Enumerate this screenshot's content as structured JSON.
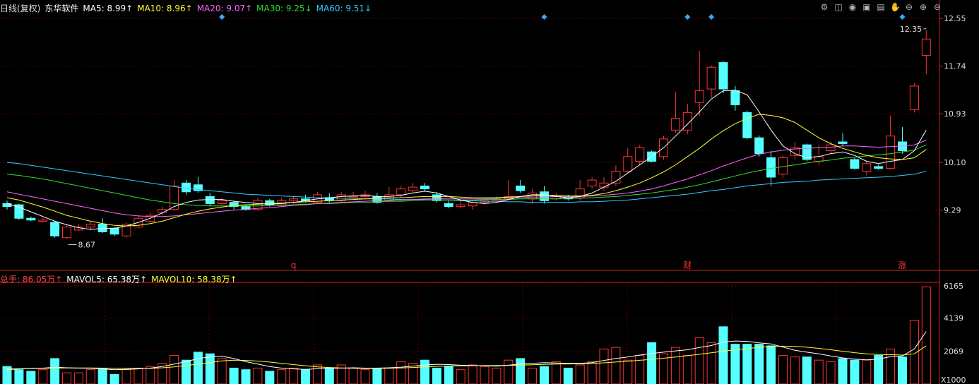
{
  "stock": {
    "title": "日线(复权)",
    "name": "东华软件"
  },
  "ma_header": [
    {
      "label": "MA5: 8.99↑",
      "color": "#ffffff"
    },
    {
      "label": "MA10: 8.96↑",
      "color": "#ffff33"
    },
    {
      "label": "MA20: 9.07↑",
      "color": "#ff66ff"
    },
    {
      "label": "MA30: 9.25↓",
      "color": "#33dd33"
    },
    {
      "label": "MA60: 9.51↓",
      "color": "#33ccff"
    }
  ],
  "vol_header": [
    {
      "label": "总手: 86.05万↑",
      "color": "#ff4444"
    },
    {
      "label": "MAVOL5: 65.38万↑",
      "color": "#ffffff"
    },
    {
      "label": "MAVOL10: 58.38万↑",
      "color": "#ffff33"
    }
  ],
  "toolbar_icons": [
    "settings-icon",
    "eye-icon",
    "lock-icon",
    "box-icon",
    "hand-icon",
    "minus-circle-icon",
    "plus-circle-icon",
    "minus-icon"
  ],
  "toolbar_glyphs": [
    "⚙",
    "◫",
    "◉",
    "▣",
    "▤",
    "✋",
    "⊖",
    "⊕",
    "⊖"
  ],
  "chart_data": {
    "type": "candlestick",
    "price_axis": {
      "ticks": [
        "12.55",
        "11.74",
        "10.93",
        "10.10",
        "9.29"
      ],
      "ylim": [
        8.3,
        12.6
      ]
    },
    "volume_axis": {
      "ticks": [
        "6165",
        "4139",
        "2069"
      ],
      "unit": "X1000"
    },
    "price_annotations": {
      "high_label": "12.35",
      "low_label": "8.67"
    },
    "markers": [
      {
        "text": "q",
        "index": 24
      },
      {
        "text": "财",
        "index": 57
      },
      {
        "text": "涨",
        "index": 75
      }
    ],
    "event_diamonds": [
      18,
      45,
      57,
      59,
      75
    ],
    "colors": {
      "up": "#ff3333",
      "down": "#55ffff",
      "grid": "#5a0000",
      "axis": "#cc2222",
      "text": "#dddddd"
    },
    "candles": [
      [
        9.4,
        9.35,
        9.45,
        9.3
      ],
      [
        9.38,
        9.15,
        9.4,
        9.12
      ],
      [
        9.15,
        9.12,
        9.18,
        9.1
      ],
      [
        9.1,
        9.12,
        9.15,
        9.08
      ],
      [
        9.08,
        8.85,
        9.1,
        8.82
      ],
      [
        8.82,
        9.0,
        9.05,
        8.8
      ],
      [
        8.95,
        9.0,
        9.05,
        8.93
      ],
      [
        9.0,
        9.05,
        9.08,
        8.95
      ],
      [
        9.05,
        8.92,
        9.15,
        8.9
      ],
      [
        8.98,
        8.88,
        9.0,
        8.85
      ],
      [
        8.85,
        9.05,
        9.08,
        8.82
      ],
      [
        9.0,
        9.15,
        9.2,
        8.98
      ],
      [
        9.1,
        9.2,
        9.25,
        9.08
      ],
      [
        9.25,
        9.3,
        9.35,
        9.2
      ],
      [
        9.3,
        9.7,
        9.8,
        9.28
      ],
      [
        9.75,
        9.6,
        9.8,
        9.55
      ],
      [
        9.72,
        9.62,
        9.85,
        9.58
      ],
      [
        9.52,
        9.4,
        9.58,
        9.35
      ],
      [
        9.4,
        9.45,
        9.5,
        9.38
      ],
      [
        9.42,
        9.35,
        9.45,
        9.3
      ],
      [
        9.35,
        9.3,
        9.38,
        9.28
      ],
      [
        9.3,
        9.45,
        9.5,
        9.28
      ],
      [
        9.45,
        9.38,
        9.48,
        9.35
      ],
      [
        9.38,
        9.45,
        9.5,
        9.35
      ],
      [
        9.45,
        9.48,
        9.52,
        9.4
      ],
      [
        9.48,
        9.45,
        9.55,
        9.42
      ],
      [
        9.42,
        9.55,
        9.6,
        9.4
      ],
      [
        9.5,
        9.45,
        9.58,
        9.42
      ],
      [
        9.45,
        9.55,
        9.6,
        9.43
      ],
      [
        9.5,
        9.52,
        9.6,
        9.48
      ],
      [
        9.52,
        9.55,
        9.62,
        9.5
      ],
      [
        9.52,
        9.42,
        9.58,
        9.4
      ],
      [
        9.45,
        9.55,
        9.68,
        9.42
      ],
      [
        9.55,
        9.65,
        9.7,
        9.5
      ],
      [
        9.62,
        9.68,
        9.75,
        9.58
      ],
      [
        9.7,
        9.65,
        9.75,
        9.6
      ],
      [
        9.55,
        9.45,
        9.6,
        9.42
      ],
      [
        9.4,
        9.35,
        9.45,
        9.32
      ],
      [
        9.35,
        9.38,
        9.45,
        9.32
      ],
      [
        9.36,
        9.42,
        9.46,
        9.3
      ],
      [
        9.42,
        9.45,
        9.5,
        9.38
      ],
      [
        9.45,
        9.48,
        9.52,
        9.42
      ],
      [
        9.48,
        9.52,
        9.8,
        9.45
      ],
      [
        9.7,
        9.62,
        9.8,
        9.58
      ],
      [
        9.48,
        9.58,
        9.65,
        9.4
      ],
      [
        9.6,
        9.45,
        9.7,
        9.4
      ],
      [
        9.48,
        9.52,
        9.58,
        9.45
      ],
      [
        9.5,
        9.48,
        9.55,
        9.45
      ],
      [
        9.5,
        9.65,
        9.8,
        9.45
      ],
      [
        9.7,
        9.8,
        9.85,
        9.65
      ],
      [
        9.68,
        9.75,
        9.85,
        9.62
      ],
      [
        9.75,
        9.95,
        10.05,
        9.7
      ],
      [
        9.95,
        10.2,
        10.35,
        9.92
      ],
      [
        10.12,
        10.35,
        10.4,
        10.05
      ],
      [
        10.28,
        10.12,
        10.3,
        10.1
      ],
      [
        10.2,
        10.5,
        10.55,
        10.15
      ],
      [
        10.65,
        10.85,
        11.3,
        10.6
      ],
      [
        10.65,
        10.95,
        11.1,
        10.58
      ],
      [
        11.12,
        11.32,
        12.0,
        10.88
      ],
      [
        11.35,
        11.72,
        11.75,
        11.2
      ],
      [
        11.8,
        11.35,
        11.82,
        11.28
      ],
      [
        11.32,
        11.08,
        11.4,
        10.98
      ],
      [
        10.95,
        10.52,
        10.98,
        10.5
      ],
      [
        10.52,
        10.25,
        10.56,
        10.2
      ],
      [
        10.18,
        9.85,
        10.3,
        9.7
      ],
      [
        9.9,
        10.18,
        10.22,
        9.84
      ],
      [
        10.22,
        10.35,
        10.45,
        10.15
      ],
      [
        10.4,
        10.15,
        10.42,
        10.12
      ],
      [
        10.12,
        10.2,
        10.4,
        10.05
      ],
      [
        10.3,
        10.4,
        10.45,
        10.25
      ],
      [
        10.45,
        10.42,
        10.6,
        10.38
      ],
      [
        10.15,
        10.0,
        10.18,
        9.98
      ],
      [
        9.95,
        10.08,
        10.12,
        9.88
      ],
      [
        10.03,
        10.0,
        10.06,
        9.98
      ],
      [
        10.0,
        10.55,
        10.9,
        9.98
      ],
      [
        10.45,
        10.3,
        10.7,
        10.25
      ],
      [
        11.0,
        11.4,
        11.45,
        10.95
      ],
      [
        11.92,
        12.2,
        12.35,
        11.6
      ]
    ],
    "ma5": [
      9.4,
      9.34,
      9.26,
      9.18,
      9.1,
      9.04,
      8.99,
      8.96,
      8.98,
      8.98,
      9.02,
      9.08,
      9.15,
      9.24,
      9.35,
      9.42,
      9.46,
      9.47,
      9.47,
      9.44,
      9.42,
      9.4,
      9.39,
      9.4,
      9.42,
      9.45,
      9.48,
      9.5,
      9.52,
      9.53,
      9.54,
      9.52,
      9.52,
      9.54,
      9.58,
      9.61,
      9.58,
      9.52,
      9.46,
      9.42,
      9.4,
      9.42,
      9.47,
      9.52,
      9.55,
      9.55,
      9.52,
      9.5,
      9.52,
      9.58,
      9.68,
      9.78,
      9.92,
      10.06,
      10.2,
      10.35,
      10.55,
      10.75,
      10.96,
      11.18,
      11.32,
      11.33,
      11.25,
      10.96,
      10.65,
      10.38,
      10.25,
      10.18,
      10.2,
      10.25,
      10.28,
      10.22,
      10.12,
      10.08,
      10.12,
      10.15,
      10.3,
      10.65
    ],
    "ma10": [
      9.5,
      9.46,
      9.4,
      9.34,
      9.27,
      9.2,
      9.15,
      9.1,
      9.06,
      9.03,
      9.02,
      9.03,
      9.06,
      9.1,
      9.16,
      9.22,
      9.27,
      9.31,
      9.34,
      9.37,
      9.38,
      9.39,
      9.4,
      9.41,
      9.42,
      9.43,
      9.44,
      9.45,
      9.46,
      9.47,
      9.48,
      9.49,
      9.5,
      9.5,
      9.51,
      9.52,
      9.52,
      9.52,
      9.51,
      9.5,
      9.5,
      9.5,
      9.51,
      9.52,
      9.53,
      9.54,
      9.54,
      9.53,
      9.53,
      9.54,
      9.57,
      9.62,
      9.68,
      9.75,
      9.84,
      9.94,
      10.06,
      10.2,
      10.34,
      10.5,
      10.64,
      10.76,
      10.85,
      10.92,
      10.9,
      10.86,
      10.78,
      10.65,
      10.52,
      10.42,
      10.34,
      10.28,
      10.22,
      10.18,
      10.16,
      10.15,
      10.18,
      10.32
    ],
    "ma20": [
      9.6,
      9.56,
      9.52,
      9.48,
      9.44,
      9.4,
      9.36,
      9.32,
      9.28,
      9.24,
      9.21,
      9.19,
      9.18,
      9.18,
      9.19,
      9.21,
      9.23,
      9.25,
      9.27,
      9.29,
      9.3,
      9.32,
      9.33,
      9.35,
      9.37,
      9.38,
      9.4,
      9.41,
      9.42,
      9.43,
      9.44,
      9.45,
      9.46,
      9.46,
      9.47,
      9.48,
      9.48,
      9.48,
      9.48,
      9.48,
      9.48,
      9.49,
      9.5,
      9.5,
      9.51,
      9.51,
      9.52,
      9.52,
      9.52,
      9.53,
      9.54,
      9.56,
      9.58,
      9.61,
      9.65,
      9.7,
      9.76,
      9.82,
      9.89,
      9.96,
      10.04,
      10.11,
      10.18,
      10.24,
      10.28,
      10.31,
      10.33,
      10.34,
      10.35,
      10.36,
      10.38,
      10.38,
      10.37,
      10.36,
      10.37,
      10.38,
      10.4,
      10.48
    ],
    "ma30": [
      9.9,
      9.88,
      9.85,
      9.82,
      9.78,
      9.74,
      9.7,
      9.66,
      9.62,
      9.58,
      9.54,
      9.5,
      9.46,
      9.43,
      9.4,
      9.38,
      9.37,
      9.36,
      9.36,
      9.36,
      9.36,
      9.36,
      9.37,
      9.37,
      9.38,
      9.39,
      9.4,
      9.4,
      9.41,
      9.42,
      9.42,
      9.43,
      9.44,
      9.44,
      9.45,
      9.46,
      9.46,
      9.46,
      9.46,
      9.46,
      9.47,
      9.47,
      9.47,
      9.48,
      9.48,
      9.48,
      9.48,
      9.49,
      9.49,
      9.5,
      9.51,
      9.52,
      9.54,
      9.56,
      9.58,
      9.61,
      9.64,
      9.68,
      9.72,
      9.77,
      9.82,
      9.87,
      9.92,
      9.96,
      10.0,
      10.03,
      10.06,
      10.09,
      10.12,
      10.14,
      10.17,
      10.19,
      10.21,
      10.23,
      10.25,
      10.28,
      10.31,
      10.4
    ],
    "ma60": [
      10.1,
      10.08,
      10.05,
      10.02,
      9.99,
      9.96,
      9.93,
      9.9,
      9.87,
      9.84,
      9.81,
      9.78,
      9.75,
      9.72,
      9.69,
      9.66,
      9.64,
      9.62,
      9.6,
      9.58,
      9.56,
      9.55,
      9.54,
      9.53,
      9.52,
      9.51,
      9.5,
      9.5,
      9.49,
      9.49,
      9.48,
      9.48,
      9.48,
      9.47,
      9.47,
      9.47,
      9.46,
      9.46,
      9.45,
      9.45,
      9.44,
      9.44,
      9.43,
      9.43,
      9.42,
      9.42,
      9.42,
      9.42,
      9.43,
      9.43,
      9.44,
      9.45,
      9.46,
      9.48,
      9.5,
      9.52,
      9.54,
      9.56,
      9.59,
      9.62,
      9.64,
      9.67,
      9.7,
      9.72,
      9.74,
      9.76,
      9.77,
      9.78,
      9.8,
      9.81,
      9.82,
      9.83,
      9.84,
      9.85,
      9.86,
      9.88,
      9.9,
      9.95
    ],
    "volume": [
      1100,
      900,
      800,
      900,
      1600,
      700,
      700,
      900,
      1000,
      600,
      900,
      1000,
      1100,
      1300,
      1800,
      1500,
      2000,
      1900,
      1600,
      1000,
      900,
      1000,
      800,
      900,
      1000,
      900,
      1200,
      1000,
      1200,
      1000,
      900,
      1000,
      1000,
      1400,
      1300,
      1500,
      1000,
      1100,
      900,
      1200,
      1100,
      1000,
      1500,
      1600,
      1000,
      1100,
      1400,
      1000,
      1200,
      1400,
      2200,
      2300,
      1500,
      1800,
      2600,
      1900,
      2300,
      1800,
      2900,
      2600,
      3600,
      2500,
      2500,
      2500,
      2400,
      1800,
      1700,
      1700,
      1500,
      1400,
      1600,
      1500,
      1500,
      1800,
      2200,
      1700,
      4000,
      6100
    ],
    "mavol5": [
      900,
      950,
      980,
      1000,
      1050,
      1020,
      1000,
      990,
      950,
      900,
      920,
      950,
      1000,
      1100,
      1250,
      1400,
      1600,
      1700,
      1750,
      1600,
      1400,
      1250,
      1100,
      1000,
      950,
      920,
      960,
      980,
      1000,
      1020,
      1000,
      1000,
      1020,
      1060,
      1120,
      1200,
      1240,
      1220,
      1180,
      1160,
      1150,
      1120,
      1180,
      1260,
      1300,
      1340,
      1320,
      1300,
      1300,
      1340,
      1480,
      1600,
      1700,
      1820,
      1920,
      2000,
      2080,
      2150,
      2300,
      2420,
      2640,
      2700,
      2680,
      2580,
      2520,
      2320,
      2120,
      2000,
      1900,
      1760,
      1640,
      1560,
      1520,
      1560,
      1720,
      1760,
      2200,
      3300
    ],
    "mavol10": [
      950,
      960,
      970,
      980,
      1000,
      1010,
      1010,
      1005,
      1000,
      990,
      980,
      975,
      980,
      1020,
      1080,
      1160,
      1250,
      1350,
      1450,
      1500,
      1480,
      1440,
      1380,
      1300,
      1220,
      1150,
      1080,
      1040,
      1010,
      990,
      970,
      980,
      990,
      1010,
      1040,
      1080,
      1110,
      1130,
      1140,
      1150,
      1160,
      1160,
      1170,
      1190,
      1210,
      1230,
      1250,
      1260,
      1270,
      1290,
      1330,
      1380,
      1430,
      1490,
      1550,
      1620,
      1700,
      1780,
      1870,
      1960,
      2060,
      2150,
      2230,
      2300,
      2360,
      2380,
      2360,
      2310,
      2240,
      2150,
      2060,
      1970,
      1900,
      1850,
      1840,
      1820,
      1900,
      2400
    ]
  }
}
